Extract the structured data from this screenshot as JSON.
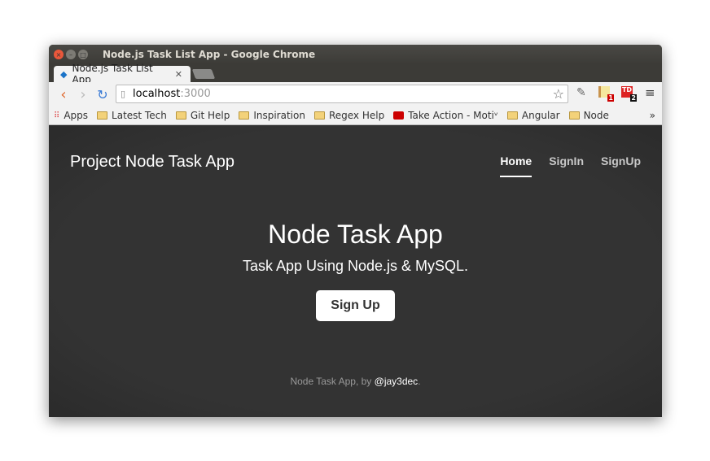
{
  "window": {
    "title": "Node.js Task List App - Google Chrome"
  },
  "tab": {
    "label": "Node.js Task List App"
  },
  "address": {
    "host": "localhost",
    "port": ":3000"
  },
  "bookmarks": [
    "Apps",
    "Latest Tech",
    "Git Help",
    "Inspiration",
    "Regex Help",
    "Take Action - Motiᵛ",
    "Angular",
    "Node"
  ],
  "extensions": {
    "badge1": "1",
    "badge2": "2"
  },
  "site": {
    "brand": "Project Node Task App",
    "nav": [
      "Home",
      "SignIn",
      "SignUp"
    ]
  },
  "hero": {
    "title": "Node Task App",
    "subtitle": "Task App Using Node.js & MySQL.",
    "button": "Sign Up"
  },
  "footer": {
    "text": "Node Task App, by ",
    "link": "@jay3dec",
    "end": "."
  }
}
